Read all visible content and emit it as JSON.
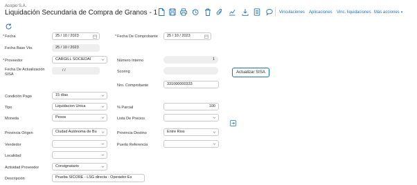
{
  "header": {
    "company": "Acopio S.A.",
    "title": "Liquidación Secundaria de Compra de Granos - 1"
  },
  "toolbar": {
    "icons": [
      "new-doc-icon",
      "save-icon",
      "print-icon",
      "history-icon",
      "delete-icon",
      "attach-icon",
      "chart-icon",
      "export-icon",
      "form-icon",
      "comment-icon"
    ],
    "links": {
      "vinculaciones": "Vinculaciones",
      "aplicaciones": "Aplicaciones",
      "vinc_liquidaciones": "Vinc. liquidaciones",
      "mas_acciones": "Más acciones"
    }
  },
  "form": {
    "fecha": {
      "label": "Fecha",
      "value": "25 / 10 / 2023"
    },
    "fecha_comprobante": {
      "label": "Fecha De Comprobante",
      "value": "25 / 10 / 2023"
    },
    "fecha_base_vto": {
      "label": "Fecha Base Vto.",
      "value": "25 / 10 / 2023"
    },
    "proveedor": {
      "label": "Proveedor",
      "value": "CARGILL SOCIEDAI"
    },
    "numero_interno": {
      "label": "Número Interno",
      "value": "1"
    },
    "fecha_actualizacion_sisa": {
      "label": "Fecha De Actualización SISA",
      "value": "/ /"
    },
    "scoring": {
      "label": "Scoring",
      "value": ""
    },
    "actualizar_sisa": {
      "label": "Actualizar SISA"
    },
    "nro_comprobante": {
      "label": "Nro. Comprobante",
      "value": "331000000333"
    },
    "condicion_pago": {
      "label": "Condición Pago",
      "value": "15 días"
    },
    "tipo": {
      "label": "Tipo",
      "value": "Liquidacion Unica"
    },
    "porc_parcial": {
      "label": "% Parcial",
      "value": "100"
    },
    "moneda": {
      "label": "Moneda",
      "value": "Pesos"
    },
    "lista_precios": {
      "label": "Lista De Precios",
      "value": ""
    },
    "provincia_origen": {
      "label": "Provincia Origen",
      "value": "Ciudad Autónoma de Bu"
    },
    "provincia_destino": {
      "label": "Provincia Destino",
      "value": "Entre Rios"
    },
    "vendedor": {
      "label": "Vendedor",
      "value": ""
    },
    "puerto_referencia": {
      "label": "Puerto Referencia",
      "value": ""
    },
    "localidad": {
      "label": "Localidad",
      "value": ""
    },
    "actividad_proveedor": {
      "label": "Actividad Proveedor",
      "value": "Consignatario"
    },
    "descripcion": {
      "label": "Descripción",
      "value": "Prueba SICORE - LSG directa - Operador Es"
    }
  },
  "colors": {
    "link": "#1e6fb8",
    "required": "#d0021b",
    "readonly_bg": "#eeeeee",
    "border": "#c9c9c9"
  }
}
